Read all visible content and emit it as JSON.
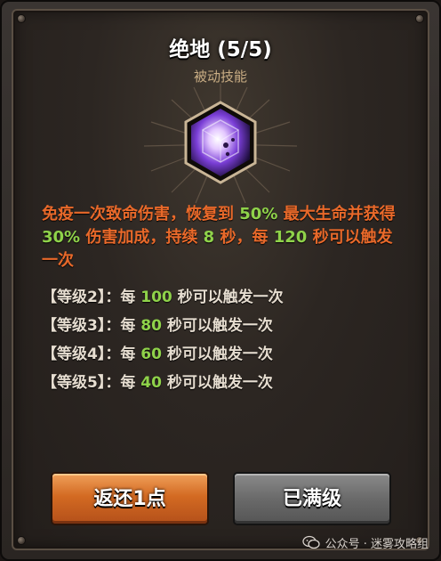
{
  "skill": {
    "name": "绝地",
    "level": "(5/5)",
    "type": "被动技能",
    "icon": "purple-crystal-cube-icon"
  },
  "description": {
    "part1": "免疫一次致命伤害，恢复到 ",
    "heal_pct": "50%",
    "part2": " 最大生命并获得 ",
    "damage_pct": "30%",
    "part3": " 伤害加成，持续 ",
    "duration": "8",
    "part4": " 秒，每 ",
    "cooldown": "120",
    "part5": " 秒可以触发一次"
  },
  "levels": [
    {
      "label": "【等级2】：每 ",
      "value": "100",
      "suffix": " 秒可以触发一次"
    },
    {
      "label": "【等级3】：每 ",
      "value": "80",
      "suffix": " 秒可以触发一次"
    },
    {
      "label": "【等级4】：每 ",
      "value": "60",
      "suffix": " 秒可以触发一次"
    },
    {
      "label": "【等级5】：每 ",
      "value": "40",
      "suffix": " 秒可以触发一次"
    }
  ],
  "buttons": {
    "refund": "返还1点",
    "maxed": "已满级"
  },
  "watermark": {
    "text": "公众号 · 迷雾攻略组"
  },
  "colors": {
    "description": "#e9692a",
    "highlight": "#8fd24a",
    "refund_button": "#d36a22",
    "maxed_button": "#6a6a6a"
  }
}
